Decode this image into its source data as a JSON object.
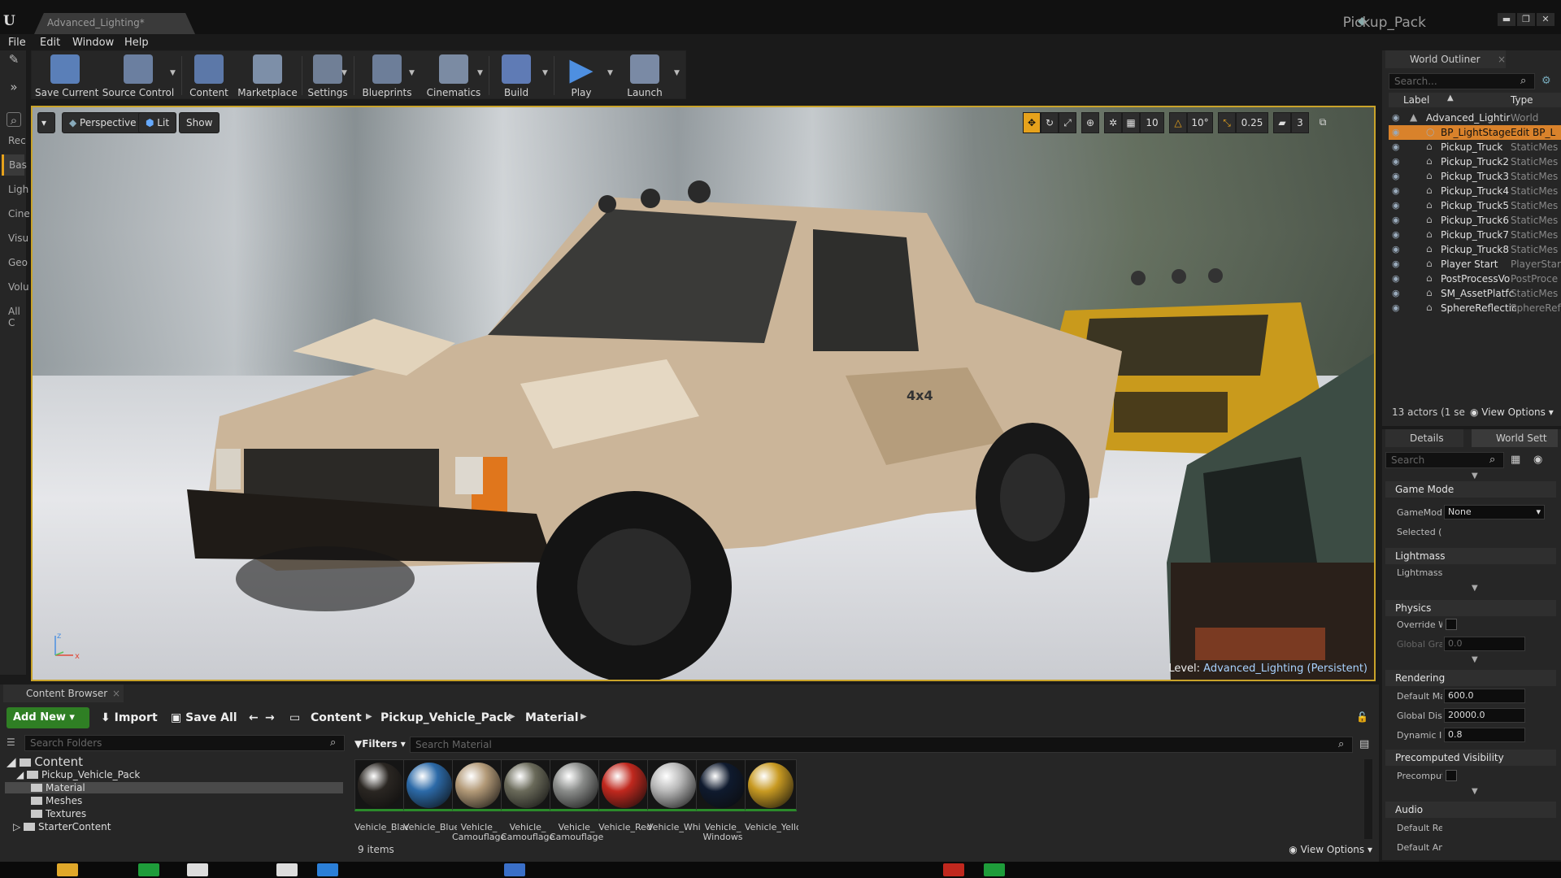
{
  "window": {
    "doc_tab": "Advanced_Lighting*",
    "project": "Pickup_Pack",
    "controls": {
      "minimize": "▬",
      "restore": "❐",
      "close": "✕"
    }
  },
  "menu": [
    "File",
    "Edit",
    "Window",
    "Help"
  ],
  "modes": {
    "tabs": [
      "Rec",
      "Bas",
      "Ligh",
      "Cine",
      "Visu",
      "Geo",
      "Volu",
      "All C"
    ],
    "active_tab": "Bas"
  },
  "toolbar": {
    "buttons": [
      {
        "label": "Save Current",
        "icon": "save-icon",
        "color": "#5a7fb8"
      },
      {
        "label": "Source Control",
        "icon": "source-control-icon",
        "color": "#6b7fa0"
      },
      {
        "label": "Content",
        "icon": "content-icon",
        "color": "#5c78a8"
      },
      {
        "label": "Marketplace",
        "icon": "marketplace-icon",
        "color": "#7d8fa8"
      },
      {
        "label": "Settings",
        "icon": "gear-icon",
        "color": "#707f96"
      },
      {
        "label": "Blueprints",
        "icon": "blueprint-icon",
        "color": "#6d7e99"
      },
      {
        "label": "Cinematics",
        "icon": "clapper-icon",
        "color": "#7b8ba3"
      },
      {
        "label": "Build",
        "icon": "build-icon",
        "color": "#5f7bb5"
      },
      {
        "label": "Play",
        "icon": "play-icon",
        "color": "#4e8fe0"
      },
      {
        "label": "Launch",
        "icon": "launch-icon",
        "color": "#7a8aa5"
      }
    ]
  },
  "viewport": {
    "perspective": "Perspective",
    "lit": "Lit",
    "show": "Show",
    "grid_snap": "10",
    "rotation_snap": "10°",
    "scale_snap": "0.25",
    "camera_speed": "3",
    "level_label": "Level:",
    "level_value": "Advanced_Lighting (Persistent)",
    "axis_x": "x",
    "axis_z": "z"
  },
  "outliner": {
    "tab": "World Outliner",
    "search_placeholder": "Search...",
    "col_label": "Label",
    "col_type": "Type",
    "rows": [
      {
        "label": "Advanced_Lightir",
        "type": "World",
        "icon": "world-icon",
        "selected": false
      },
      {
        "label": "BP_LightStage",
        "type": "Edit BP_L",
        "icon": "blueprint-actor-icon",
        "selected": true
      },
      {
        "label": "Pickup_Truck",
        "type": "StaticMes",
        "icon": "static-mesh-icon",
        "selected": false
      },
      {
        "label": "Pickup_Truck2",
        "type": "StaticMes",
        "icon": "static-mesh-icon",
        "selected": false
      },
      {
        "label": "Pickup_Truck3",
        "type": "StaticMes",
        "icon": "static-mesh-icon",
        "selected": false
      },
      {
        "label": "Pickup_Truck4",
        "type": "StaticMes",
        "icon": "static-mesh-icon",
        "selected": false
      },
      {
        "label": "Pickup_Truck5",
        "type": "StaticMes",
        "icon": "static-mesh-icon",
        "selected": false
      },
      {
        "label": "Pickup_Truck6",
        "type": "StaticMes",
        "icon": "static-mesh-icon",
        "selected": false
      },
      {
        "label": "Pickup_Truck7",
        "type": "StaticMes",
        "icon": "static-mesh-icon",
        "selected": false
      },
      {
        "label": "Pickup_Truck8",
        "type": "StaticMes",
        "icon": "static-mesh-icon",
        "selected": false
      },
      {
        "label": "Player Start",
        "type": "PlayerStar",
        "icon": "player-start-icon",
        "selected": false
      },
      {
        "label": "PostProcessVo",
        "type": "PostProce",
        "icon": "post-process-icon",
        "selected": false
      },
      {
        "label": "SM_AssetPlatfc",
        "type": "StaticMes",
        "icon": "static-mesh-icon",
        "selected": false
      },
      {
        "label": "SphereReflectic",
        "type": "SphereRef",
        "icon": "sphere-reflection-icon",
        "selected": false
      }
    ],
    "footer_count": "13 actors (1 se",
    "view_options": "View Options"
  },
  "details": {
    "tab_details": "Details",
    "tab_world": "World Sett",
    "search_placeholder": "Search",
    "sections": [
      {
        "title": "Game Mode",
        "props": [
          {
            "name": "GameMod",
            "value": "None",
            "kind": "dropdown"
          },
          {
            "name": "Selected (",
            "kind": "expand"
          }
        ]
      },
      {
        "title": "Lightmass",
        "props": [
          {
            "name": "Lightmass",
            "kind": "expand"
          }
        ]
      },
      {
        "title": "Physics",
        "props": [
          {
            "name": "Override W",
            "kind": "check"
          },
          {
            "name": "Global Grav",
            "value": "0.0",
            "kind": "field-disabled"
          }
        ]
      },
      {
        "title": "Rendering",
        "props": [
          {
            "name": "Default Ma",
            "value": "600.0",
            "kind": "field"
          },
          {
            "name": "Global Dist",
            "value": "20000.0",
            "kind": "field"
          },
          {
            "name": "Dynamic In",
            "value": "0.8",
            "kind": "field"
          }
        ]
      },
      {
        "title": "Precomputed Visibility",
        "props": [
          {
            "name": "Precomput",
            "kind": "check"
          }
        ]
      },
      {
        "title": "Audio",
        "props": [
          {
            "name": "Default Re",
            "kind": "expand"
          },
          {
            "name": "Default Am",
            "kind": "expand"
          }
        ]
      }
    ]
  },
  "content_browser": {
    "tab": "Content Browser",
    "add_new": "Add New",
    "import": "Import",
    "save_all": "Save All",
    "breadcrumbs": [
      "Content",
      "Pickup_Vehicle_Pack",
      "Material"
    ],
    "search_folders": "Search Folders",
    "filters": "Filters",
    "search_material": "Search Material",
    "tree": [
      {
        "label": "Content",
        "depth": 0,
        "selected": false
      },
      {
        "label": "Pickup_Vehicle_Pack",
        "depth": 1,
        "selected": false
      },
      {
        "label": "Material",
        "depth": 2,
        "selected": true
      },
      {
        "label": "Meshes",
        "depth": 2,
        "selected": false
      },
      {
        "label": "Textures",
        "depth": 2,
        "selected": false
      },
      {
        "label": "StarterContent",
        "depth": 1,
        "selected": false
      }
    ],
    "assets": [
      {
        "label": "Vehicle_Black",
        "color": "#2a2622"
      },
      {
        "label": "Vehicle_Blue",
        "color": "#2c6aa8"
      },
      {
        "label": "Vehicle_\nCamouflage_",
        "color": "#b39a78"
      },
      {
        "label": "Vehicle_\nCamouflage_",
        "color": "#6a6a5a"
      },
      {
        "label": "Vehicle_\nCamouflage_",
        "color": "#8a8c8a"
      },
      {
        "label": "Vehicle_Red",
        "color": "#c0281e"
      },
      {
        "label": "Vehicle_White",
        "color": "#b8b8b8"
      },
      {
        "label": "Vehicle_\nWindows",
        "color": "#0f1a2e"
      },
      {
        "label": "Vehicle_Yellow",
        "color": "#c89a22"
      }
    ],
    "item_count": "9 items",
    "view_options": "View Options"
  }
}
